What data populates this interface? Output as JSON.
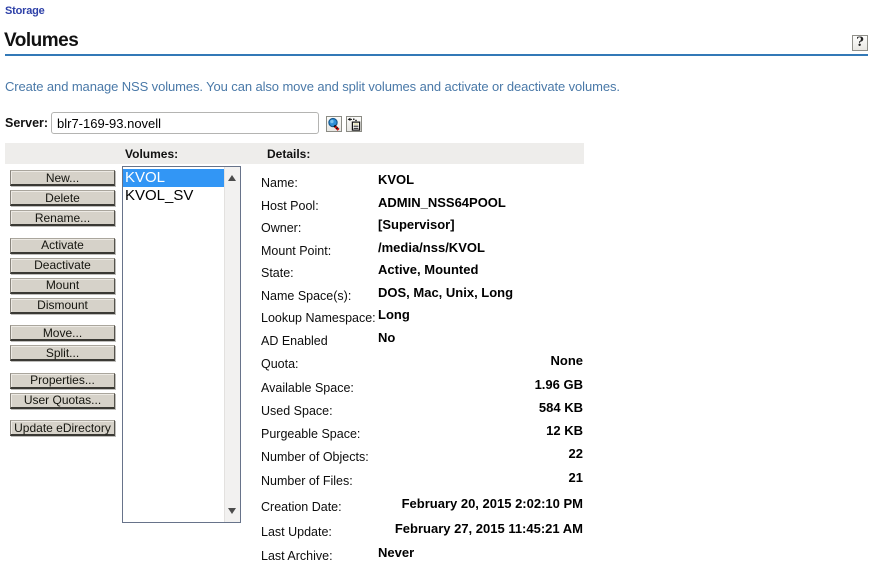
{
  "breadcrumb": {
    "label": "Storage"
  },
  "page": {
    "title": "Volumes",
    "help_label": "?",
    "description": "Create and manage NSS volumes. You can also move and split volumes and activate or deactivate volumes."
  },
  "server": {
    "label": "Server:",
    "value": "blr7-169-93.novell"
  },
  "panel": {
    "volumes_header": "Volumes:",
    "details_header": "Details:",
    "action_buttons": [
      {
        "label": "New..."
      },
      {
        "label": "Delete"
      },
      {
        "label": "Rename..."
      },
      {
        "label": "Activate",
        "group_start": true
      },
      {
        "label": "Deactivate"
      },
      {
        "label": "Mount"
      },
      {
        "label": "Dismount"
      },
      {
        "label": "Move...",
        "group_start": true
      },
      {
        "label": "Split..."
      },
      {
        "label": "Properties...",
        "group_start": true
      },
      {
        "label": "User Quotas..."
      },
      {
        "label": "Update eDirectory",
        "group_start": true
      }
    ],
    "volumes": [
      {
        "name": "KVOL",
        "selected": true
      },
      {
        "name": "KVOL_SV",
        "selected": false
      }
    ],
    "details": [
      {
        "label": "Name:",
        "value": "KVOL",
        "align": "left"
      },
      {
        "label": "Host Pool:",
        "value": "ADMIN_NSS64POOL",
        "align": "left"
      },
      {
        "label": "Owner:",
        "value": "[Supervisor]",
        "align": "left"
      },
      {
        "label": "Mount Point:",
        "value": "/media/nss/KVOL",
        "align": "left"
      },
      {
        "label": "State:",
        "value": "Active, Mounted",
        "align": "left"
      },
      {
        "label": "Name Space(s):",
        "value": "DOS, Mac, Unix, Long",
        "align": "left"
      },
      {
        "label": "Lookup Namespace:",
        "value": "Long",
        "align": "left"
      },
      {
        "label": "AD Enabled",
        "value": "No",
        "align": "left"
      },
      {
        "label": "Quota:",
        "value": "None",
        "align": "right"
      },
      {
        "label": "Available Space:",
        "value": "1.96 GB",
        "align": "right"
      },
      {
        "label": "Used Space:",
        "value": "584 KB",
        "align": "right"
      },
      {
        "label": "Purgeable Space:",
        "value": "12 KB",
        "align": "right"
      },
      {
        "label": "Number of Objects:",
        "value": "22",
        "align": "right"
      },
      {
        "label": "Number of Files:",
        "value": "21",
        "align": "right"
      },
      {
        "label": "Creation Date:",
        "value": "February 20, 2015 2:02:10 PM",
        "align": "right"
      },
      {
        "label": "Last Update:",
        "value": "February 27, 2015 11:45:21 AM",
        "align": "right"
      },
      {
        "label": "Last Archive:",
        "value": "Never",
        "align": "left"
      }
    ]
  },
  "colors": {
    "accent_rule": "#3379b7",
    "description_text": "#4a79a8",
    "breadcrumb_link": "#3348ae",
    "selection": "#3296f5",
    "button_face": "#d6d2c9",
    "header_strip": "#eeedeb"
  }
}
